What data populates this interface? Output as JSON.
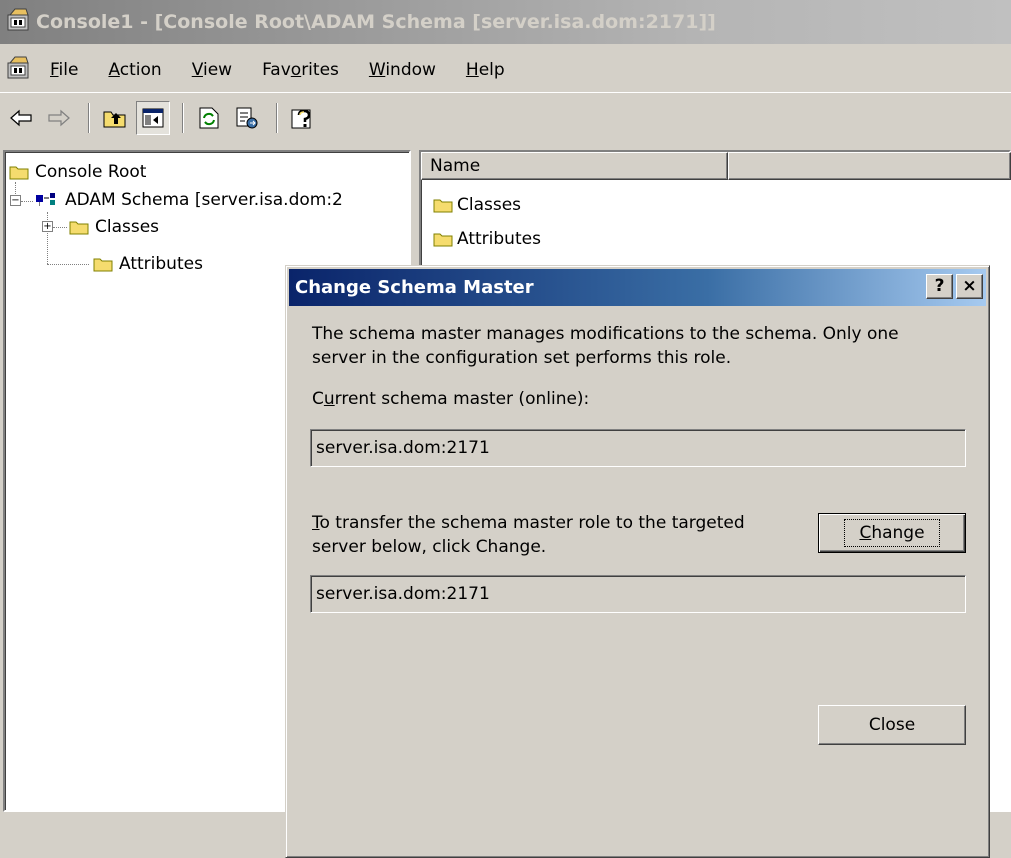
{
  "window": {
    "title": "Console1 - [Console Root\\ADAM Schema [server.isa.dom:2171]]"
  },
  "menu": [
    {
      "acc": "F",
      "rest": "ile"
    },
    {
      "acc": "A",
      "rest": "ction"
    },
    {
      "acc": "V",
      "rest": "iew"
    },
    {
      "pre": "Fav",
      "acc": "o",
      "rest": "rites"
    },
    {
      "acc": "W",
      "rest": "indow"
    },
    {
      "acc": "H",
      "rest": "elp"
    }
  ],
  "toolbar": {
    "icons": [
      "back-icon",
      "forward-icon",
      "up-one-level-icon",
      "show-hide-tree-icon",
      "refresh-icon",
      "export-list-icon",
      "help-icon"
    ]
  },
  "tree": {
    "root": "Console Root",
    "schema": "ADAM Schema [server.isa.dom:2",
    "classes": "Classes",
    "attributes": "Attributes"
  },
  "list": {
    "columns": [
      "Name",
      ""
    ],
    "items": [
      "Classes",
      "Attributes"
    ]
  },
  "dialog": {
    "title": "Change Schema Master",
    "help_button": "?",
    "close_x": "×",
    "description_line1": "The schema master manages modifications to the schema. Only one",
    "description_line2": "server in the configuration set performs this role.",
    "current_label_pre": "C",
    "current_label_acc": "u",
    "current_label_rest": "rrent schema master (online):",
    "current_value": "server.isa.dom:2171",
    "transfer_acc": "T",
    "transfer_line1_rest": "o transfer the schema master role to the targeted",
    "transfer_line2": "server below, click Change.",
    "target_value": "server.isa.dom:2171",
    "change_acc": "C",
    "change_rest": "hange",
    "close_button": "Close"
  },
  "colors": {
    "dialog_title_start": "#0a246a",
    "dialog_title_end": "#a6caf0",
    "window_face": "#d4d0c8",
    "folder": "#f5dc6e"
  }
}
